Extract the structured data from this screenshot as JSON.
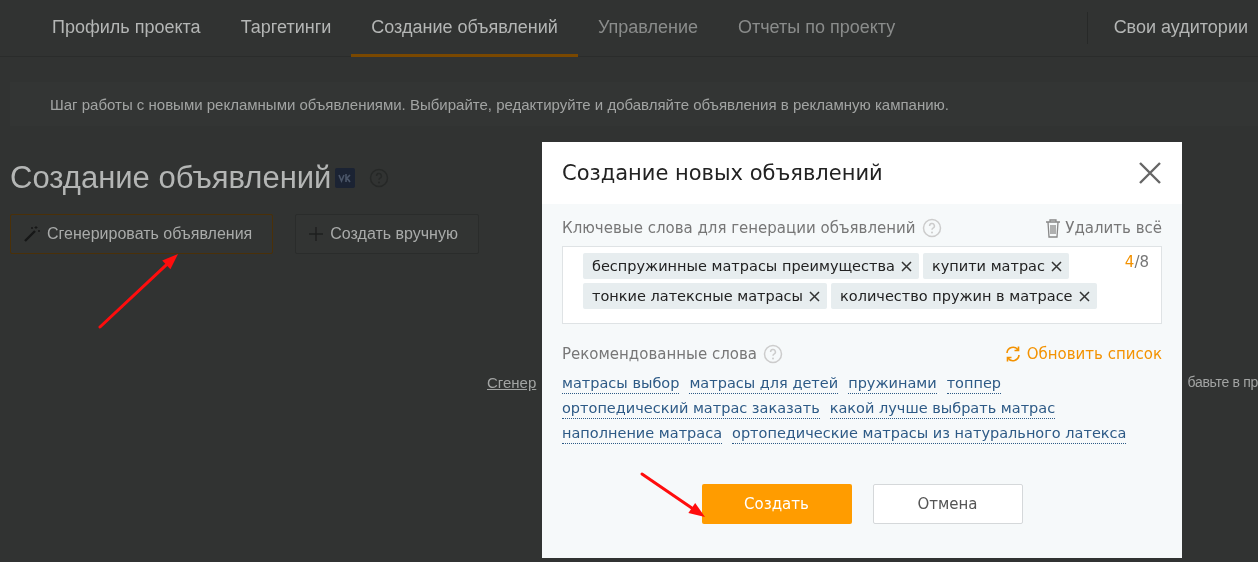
{
  "tabs": [
    {
      "label": "Профиль проекта",
      "selected": false,
      "disabled": false
    },
    {
      "label": "Таргетинги",
      "selected": false,
      "disabled": false
    },
    {
      "label": "Создание объявлений",
      "selected": true,
      "disabled": false
    },
    {
      "label": "Управление",
      "selected": false,
      "disabled": true
    },
    {
      "label": "Отчеты по проекту",
      "selected": false,
      "disabled": true
    }
  ],
  "side_tab": "Свои аудитории",
  "banner": "Шаг работы с новыми рекламными объявлениями. Выбирайте, редактируйте и добавляйте объявления в рекламную кампанию.",
  "page_title": "Создание объявлений",
  "page_buttons": [
    {
      "label": "Сгенерировать объявления",
      "kind": "generate",
      "selected": true
    },
    {
      "label": "Создать вручную",
      "kind": "manual",
      "selected": false
    }
  ],
  "hidden_text": {
    "left": "Сгенер",
    "right": "бавьте в пр"
  },
  "dialog": {
    "title": "Создание новых объявлений",
    "keywords_label": "Ключевые слова для генерации объявлений",
    "delete_all": "Удалить всё",
    "tags": [
      "беспружинные матрасы преимущества",
      "купити матрас",
      "тонкие латексные матрасы",
      "количество пружин в матрасе"
    ],
    "counter": {
      "current": "4",
      "max": "/8"
    },
    "recommended_label": "Рекомендованные слова",
    "refresh": "Обновить список",
    "recommended": [
      [
        "матрасы выбор",
        "матрасы для детей",
        "пружинами",
        "топпер"
      ],
      [
        "ортопедический матрас заказать",
        "какой лучше выбрать матрас"
      ],
      [
        "наполнение матраса",
        "ортопедические матрасы из натурального латекса"
      ]
    ],
    "buttons": [
      {
        "label": "Создать",
        "kind": "primary"
      },
      {
        "label": "Отмена",
        "kind": "secondary"
      }
    ]
  }
}
